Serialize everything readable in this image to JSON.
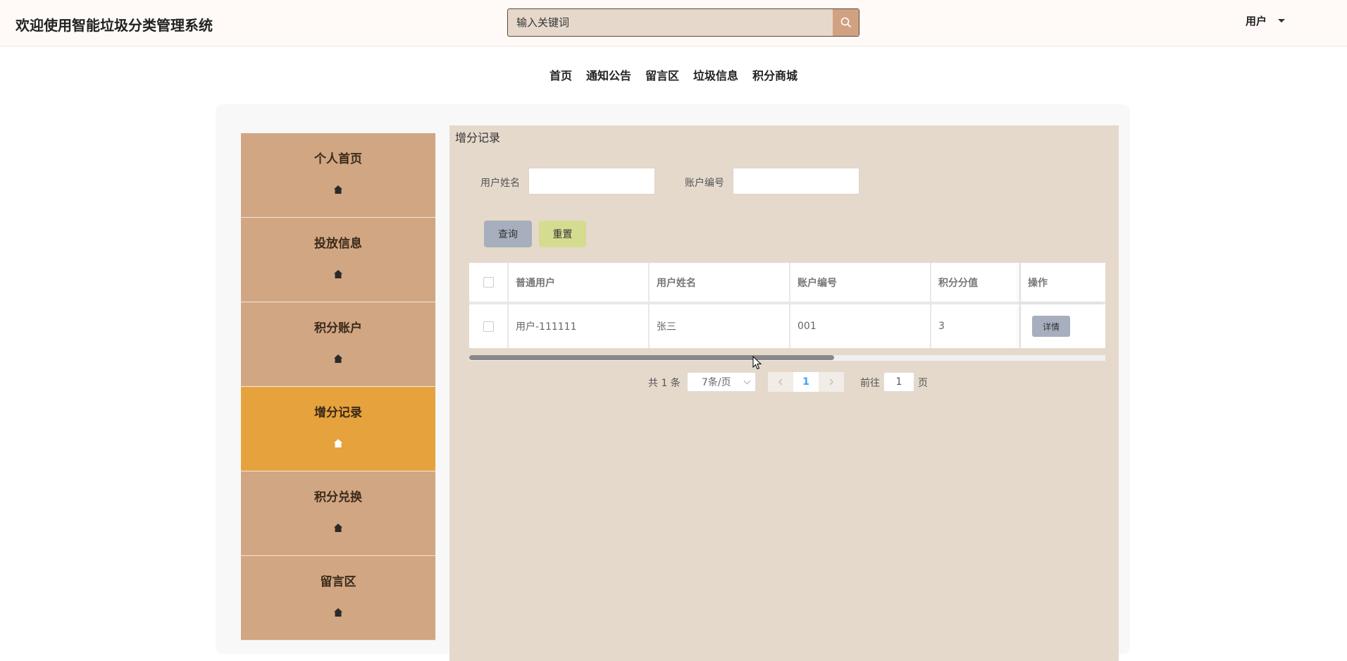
{
  "header": {
    "title": "欢迎使用智能垃圾分类管理系统",
    "search_placeholder": "输入关键词",
    "user_label": "用户"
  },
  "nav": [
    "首页",
    "通知公告",
    "留言区",
    "垃圾信息",
    "积分商城"
  ],
  "sidebar": {
    "items": [
      {
        "label": "个人首页",
        "icon": "home-icon",
        "active": false
      },
      {
        "label": "投放信息",
        "icon": "home-icon",
        "active": false
      },
      {
        "label": "积分账户",
        "icon": "home-icon",
        "active": false
      },
      {
        "label": "增分记录",
        "icon": "home-icon",
        "active": true
      },
      {
        "label": "积分兑换",
        "icon": "home-icon",
        "active": false
      },
      {
        "label": "留言区",
        "icon": "home-icon",
        "active": false
      }
    ]
  },
  "content": {
    "title": "增分记录",
    "filters": {
      "name_label": "用户姓名",
      "name_value": "",
      "account_label": "账户编号",
      "account_value": ""
    },
    "buttons": {
      "query": "查询",
      "reset": "重置"
    },
    "table": {
      "columns": [
        "普通用户",
        "用户姓名",
        "账户编号",
        "积分分值",
        "操作"
      ],
      "rows": [
        {
          "user": "用户-111111",
          "name": "张三",
          "account": "001",
          "points": "3",
          "action": "详情"
        }
      ]
    },
    "pagination": {
      "total": "共 1 条",
      "page_size": "7条/页",
      "current_page": "1",
      "goto_label": "前往",
      "goto_value": "1",
      "page_unit": "页"
    }
  },
  "colors": {
    "sidebar": "#d1a682",
    "sidebar_active": "#e6a23c",
    "content_bg": "#e5d9cc",
    "query_button": "#a7aebd",
    "reset_button": "#d5dc90",
    "search_button": "#d1a281"
  }
}
